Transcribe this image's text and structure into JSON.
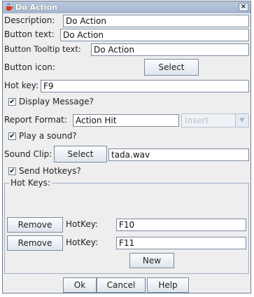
{
  "window": {
    "title": "Do Action",
    "close_glyph": "×",
    "icon": "java-cup-icon"
  },
  "description": {
    "label": "Description:",
    "value": "Do Action"
  },
  "button_text": {
    "label": "Button text:",
    "value": "Do Action"
  },
  "button_tooltip": {
    "label": "Button Tooltip text:",
    "value": "Do Action"
  },
  "button_icon": {
    "label": "Button icon:",
    "select_label": "Select"
  },
  "hot_key": {
    "label": "Hot key:",
    "value": "F9"
  },
  "display_message": {
    "label": "Display Message?",
    "checked": true
  },
  "report_format": {
    "label": "Report Format:",
    "value": "Action Hit",
    "insert_label": "Insert"
  },
  "play_sound": {
    "label": "Play a sound?",
    "checked": true
  },
  "sound_clip": {
    "label": "Sound Clip:",
    "select_label": "Select",
    "value": "tada.wav"
  },
  "send_hotkeys": {
    "label": "Send Hotkeys?",
    "checked": true
  },
  "hot_keys_group": {
    "title": "Hot Keys:",
    "rows": [
      {
        "remove_label": "Remove",
        "hotkey_label": "HotKey:",
        "value": "F10"
      },
      {
        "remove_label": "Remove",
        "hotkey_label": "HotKey:",
        "value": "F11"
      }
    ],
    "new_label": "New"
  },
  "footer": {
    "ok_label": "Ok",
    "cancel_label": "Cancel",
    "help_label": "Help"
  },
  "check_glyph": "✔",
  "colors": {
    "titlebar": "#a4b5cd",
    "border": "#7a8aa0",
    "background": "#eeeeee"
  }
}
